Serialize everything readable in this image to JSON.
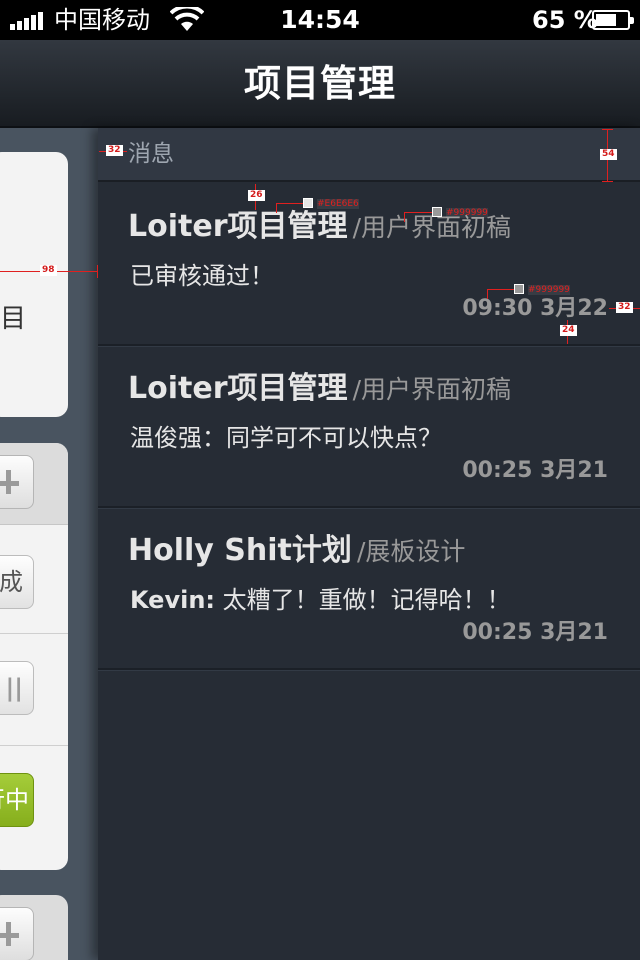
{
  "status_bar": {
    "carrier": "中国移动",
    "time": "14:54",
    "battery_percent": "65 %",
    "battery_level": 0.65
  },
  "nav": {
    "title": "项目管理"
  },
  "left_panel": {
    "card1_text": "目",
    "btn_done": "成",
    "btn_pause": "||",
    "btn_progress": "行中"
  },
  "section": {
    "title": "消息"
  },
  "messages": [
    {
      "project": "Loiter项目管理",
      "subtitle": "/用户界面初稿",
      "sender": "",
      "body": "已审核通过！",
      "time": "09:30 3月22"
    },
    {
      "project": "Loiter项目管理",
      "subtitle": "/用户界面初稿",
      "sender": "",
      "body": "温俊强：同学可不可以快点？",
      "time": "00:25 3月21"
    },
    {
      "project": "Holly Shit计划",
      "subtitle": "/展板设计",
      "sender": "Kevin:",
      "body": " 太糟了！重做！记得哈！！",
      "time": "00:25 3月21"
    }
  ],
  "annotations": {
    "header_left_pad": "32",
    "header_height": "54",
    "title_top_pad": "26",
    "title_color": "#E6E6E6",
    "subtitle_color": "#999999",
    "time_color": "#999999",
    "left_offset": "98",
    "time_right_pad": "32",
    "time_bottom_pad": "24"
  },
  "colors": {
    "title": "#E6E6E6",
    "subtitle": "#999999",
    "accent_green": "#95BE2A",
    "main_bg": "#262C35"
  }
}
